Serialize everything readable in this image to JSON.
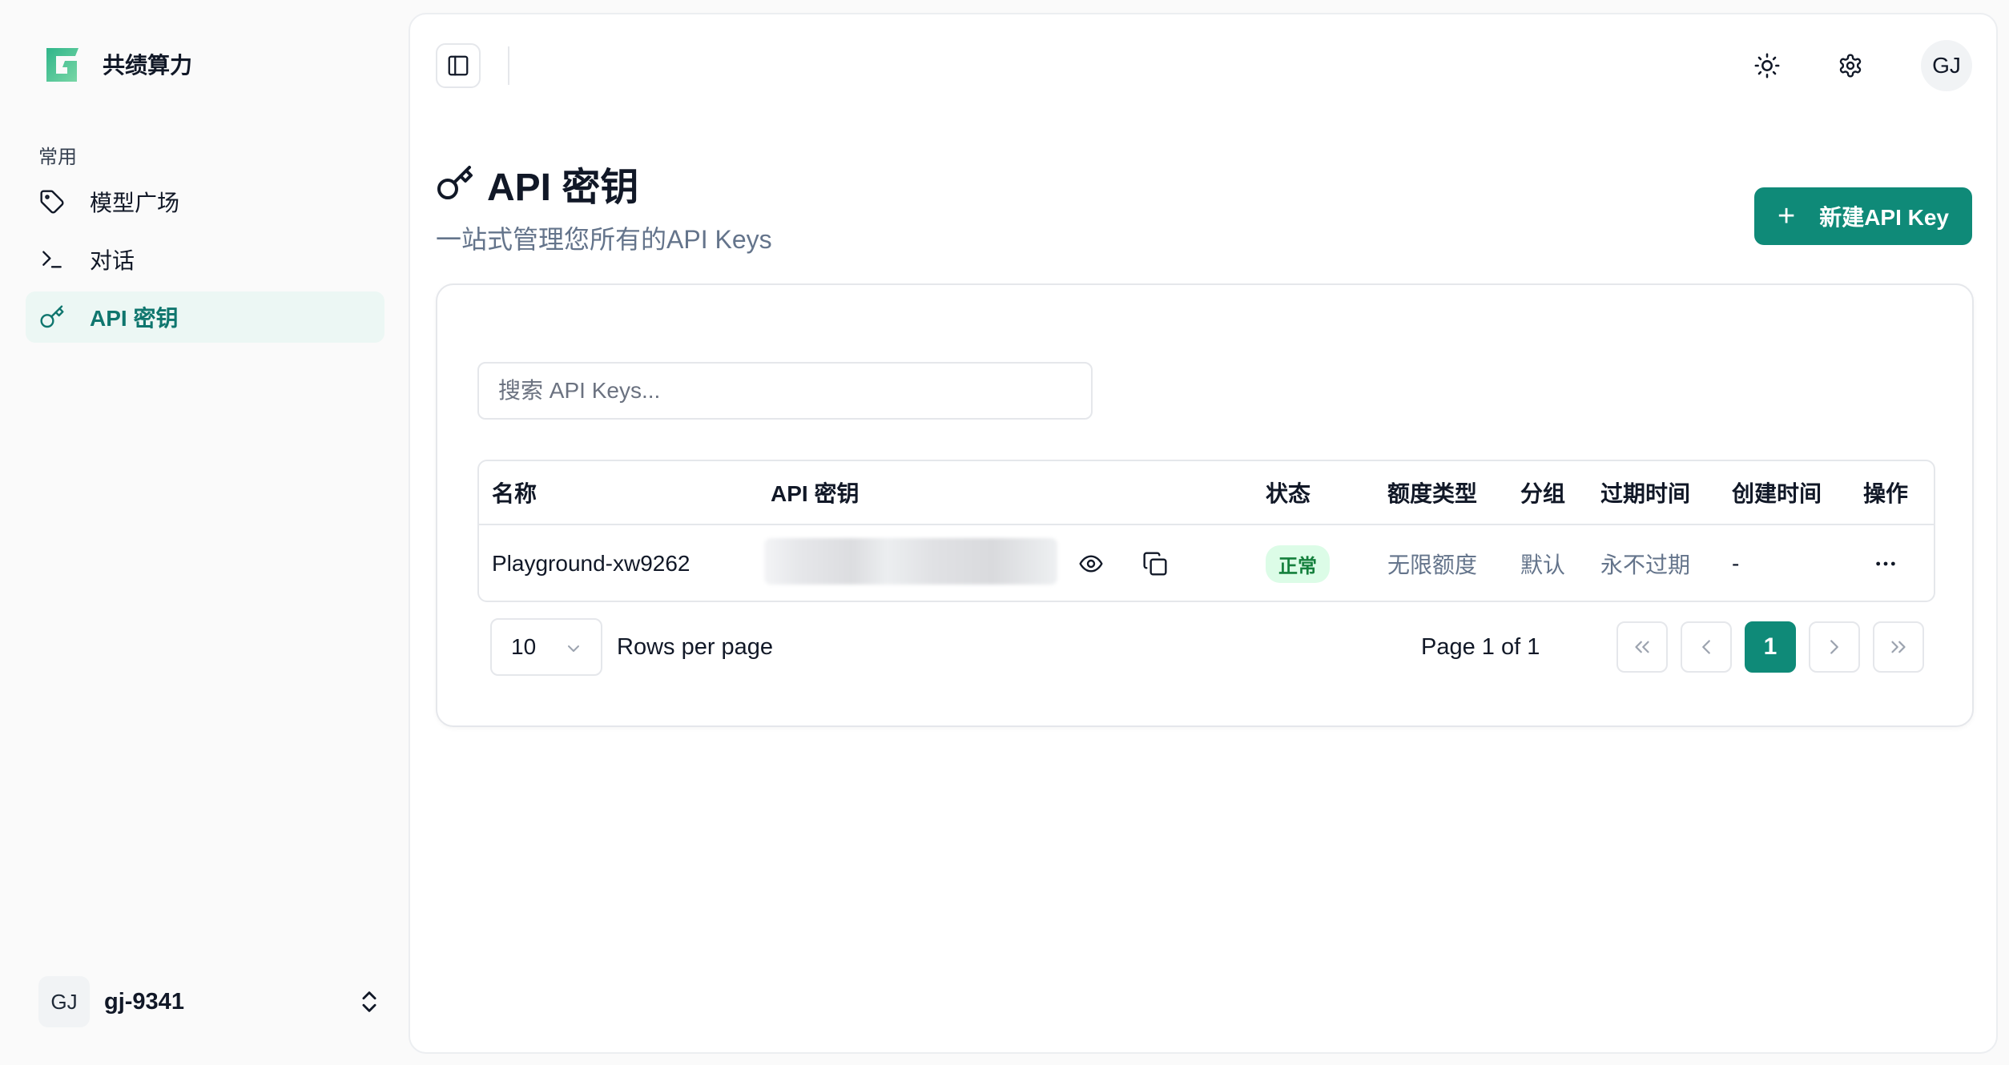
{
  "sidebar": {
    "brand_name": "共绩算力",
    "section_label": "常用",
    "items": [
      {
        "label": "模型广场",
        "icon": "tag-icon"
      },
      {
        "label": "对话",
        "icon": "terminal-icon"
      },
      {
        "label": "API 密钥",
        "icon": "key-icon",
        "active": true
      }
    ],
    "user": {
      "initials": "GJ",
      "name": "gj-9341"
    }
  },
  "topbar": {
    "avatar_initials": "GJ"
  },
  "page": {
    "title": "API 密钥",
    "subtitle": "一站式管理您所有的API Keys",
    "new_button": "新建API Key",
    "new_button_icon": "+"
  },
  "search": {
    "placeholder": "搜索 API Keys..."
  },
  "table": {
    "columns": [
      "名称",
      "API 密钥",
      "状态",
      "额度类型",
      "分组",
      "过期时间",
      "创建时间",
      "操作"
    ],
    "rows": [
      {
        "name": "Playground-xw9262",
        "status": "正常",
        "quota_type": "无限额度",
        "group": "默认",
        "expire": "永不过期",
        "created": "-"
      }
    ]
  },
  "pagination": {
    "rows_per_page_value": "10",
    "rows_per_page_label": "Rows per page",
    "page_info": "Page 1 of 1",
    "current_page": "1"
  },
  "colors": {
    "accent": "#0f8a78",
    "active_bg": "#ecf7f4",
    "badge_bg": "#dcfce7",
    "badge_text": "#15803d"
  }
}
